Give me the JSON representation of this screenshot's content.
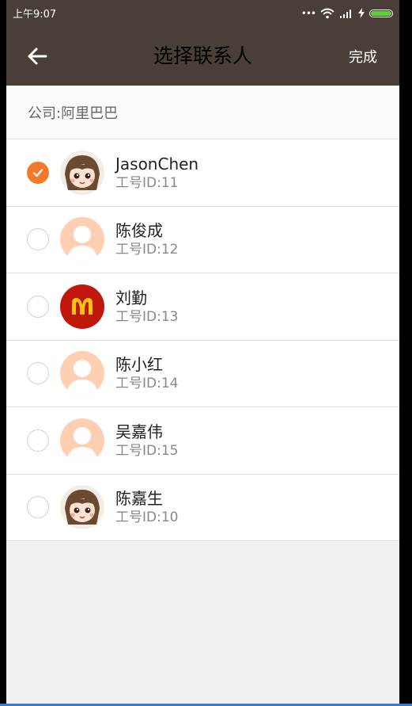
{
  "status": {
    "time": "上午9:07",
    "signal_dots": "•••"
  },
  "header": {
    "title": "选择联系人",
    "done_label": "完成"
  },
  "company": {
    "label": "公司:阿里巴巴"
  },
  "colors": {
    "accent": "#f5792b",
    "header_bg": "#4a3f38",
    "avatar_placeholder": "#ffcfb4",
    "mcd_red": "#c0170b",
    "mcd_yellow": "#ffc414"
  },
  "contacts": [
    {
      "name": "JasonChen",
      "eid": "工号ID:11",
      "selected": true,
      "avatar": "anime-girl-icon"
    },
    {
      "name": "陈俊成",
      "eid": "工号ID:12",
      "selected": false,
      "avatar": "default-person-icon"
    },
    {
      "name": "刘勤",
      "eid": "工号ID:13",
      "selected": false,
      "avatar": "mcdonalds-logo-icon"
    },
    {
      "name": "陈小红",
      "eid": "工号ID:14",
      "selected": false,
      "avatar": "default-person-icon"
    },
    {
      "name": "吴嘉伟",
      "eid": "工号ID:15",
      "selected": false,
      "avatar": "default-person-icon"
    },
    {
      "name": "陈嘉生",
      "eid": "工号ID:10",
      "selected": false,
      "avatar": "anime-girl-icon"
    }
  ]
}
